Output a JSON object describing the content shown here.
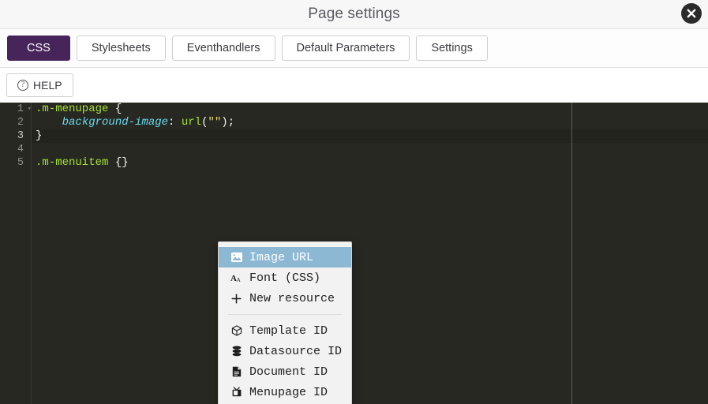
{
  "window": {
    "title": "Page settings",
    "close_icon": "close-circle-icon"
  },
  "tabs": [
    {
      "label": "CSS",
      "active": true
    },
    {
      "label": "Stylesheets",
      "active": false
    },
    {
      "label": "Eventhandlers",
      "active": false
    },
    {
      "label": "Default Parameters",
      "active": false
    },
    {
      "label": "Settings",
      "active": false
    }
  ],
  "toolbar": {
    "help_label": "HELP",
    "help_icon": "question-circle-icon"
  },
  "editor": {
    "language": "CSS",
    "active_line": 3,
    "gutter": [
      "1",
      "2",
      "3",
      "4",
      "5"
    ],
    "fold_marker": "▾",
    "lines": [
      {
        "n": "1",
        "tokens": [
          {
            "t": ".m-menupage",
            "c": "t-sel"
          },
          {
            "t": " ",
            "c": "t-punc"
          },
          {
            "t": "{",
            "c": "t-punc"
          }
        ]
      },
      {
        "n": "2",
        "tokens": [
          {
            "t": "    ",
            "c": "t-punc"
          },
          {
            "t": "background-image",
            "c": "t-prop"
          },
          {
            "t": ":",
            "c": "t-colon"
          },
          {
            "t": " ",
            "c": "t-punc"
          },
          {
            "t": "url",
            "c": "t-fn"
          },
          {
            "t": "(",
            "c": "t-punc"
          },
          {
            "t": "\"\"",
            "c": "t-str"
          },
          {
            "t": ")",
            "c": "t-punc"
          },
          {
            "t": ";",
            "c": "t-punc"
          }
        ]
      },
      {
        "n": "3",
        "tokens": [
          {
            "t": "}",
            "c": "t-punc"
          }
        ]
      },
      {
        "n": "4",
        "tokens": [
          {
            "t": "",
            "c": "t-punc"
          }
        ]
      },
      {
        "n": "5",
        "tokens": [
          {
            "t": ".m-menuitem",
            "c": "t-sel"
          },
          {
            "t": " ",
            "c": "t-punc"
          },
          {
            "t": "{}",
            "c": "t-punc"
          }
        ]
      }
    ],
    "plain_text": [
      ".m-menupage {",
      "    background-image: url(\"\");",
      "}",
      "",
      ".m-menuitem {}"
    ]
  },
  "context_menu": {
    "groups": [
      {
        "items": [
          {
            "label": "Image URL",
            "icon": "image-icon",
            "selected": true
          },
          {
            "label": "Font (CSS)",
            "icon": "font-icon",
            "selected": false
          },
          {
            "label": "New resource",
            "icon": "plus-icon",
            "selected": false
          }
        ]
      },
      {
        "items": [
          {
            "label": "Template ID",
            "icon": "cube-icon",
            "selected": false
          },
          {
            "label": "Datasource ID",
            "icon": "database-icon",
            "selected": false
          },
          {
            "label": "Document ID",
            "icon": "document-icon",
            "selected": false
          },
          {
            "label": "Menupage ID",
            "icon": "menupage-icon",
            "selected": false
          }
        ]
      }
    ]
  },
  "colors": {
    "accent_purple": "#472459",
    "menu_highlight": "#8cb8d4",
    "editor_bg": "#272822",
    "active_line_bg": "#22231d",
    "titlebar_bg": "#f7f7f7",
    "selector_green": "#a6e22e",
    "property_cyan": "#66d9ef",
    "string_yellow": "#e6db74"
  }
}
